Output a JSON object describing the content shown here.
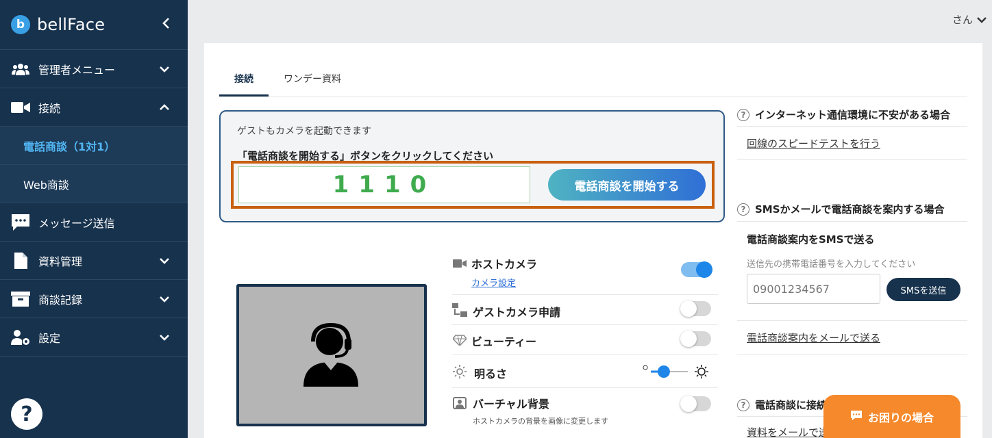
{
  "brand": {
    "logo_letter": "b",
    "name": "bellFace"
  },
  "sidebar": {
    "items": [
      {
        "label": "管理者メニュー",
        "icon": "users-icon",
        "expanded": false
      },
      {
        "label": "接続",
        "icon": "video-camera-icon",
        "expanded": true
      },
      {
        "label": "電話商談（1対1）",
        "sub": true,
        "active": true
      },
      {
        "label": "Web商談",
        "sub": true
      },
      {
        "label": "メッセージ送信",
        "icon": "chat-icon"
      },
      {
        "label": "資料管理",
        "icon": "document-icon",
        "expanded": false
      },
      {
        "label": "商談記録",
        "icon": "archive-icon",
        "expanded": false
      },
      {
        "label": "設定",
        "icon": "user-gear-icon",
        "expanded": false
      }
    ],
    "help_label": "?"
  },
  "header": {
    "user_label": "さん"
  },
  "tabs": [
    {
      "label": "接続",
      "active": true
    },
    {
      "label": "ワンデー資料",
      "active": false
    }
  ],
  "start": {
    "note": "ゲストもカメラを起動できます",
    "instruction": "「電話商談を開始する」ボタンをクリックしてください",
    "code": "1110",
    "button_label": "電話商談を開始する"
  },
  "settings": {
    "host_camera": {
      "label": "ホストカメラ",
      "link": "カメラ設定",
      "on": true
    },
    "guest_camera": {
      "label": "ゲストカメラ申請",
      "on": false
    },
    "beauty": {
      "label": "ビューティー",
      "on": false
    },
    "brightness": {
      "label": "明るさ",
      "level": 0.35
    },
    "virtual_bg": {
      "label": "バーチャル背景",
      "desc": "ホストカメラの背景を画像に変更します",
      "on": false
    }
  },
  "right": {
    "internet": {
      "title": "インターネット通信環境に不安がある場合",
      "link": "回線のスピードテストを行う"
    },
    "sms": {
      "title": "SMSかメールで電話商談を案内する場合",
      "sub": "電話商談案内をSMSで送る",
      "hint": "送信先の携帯電話番号を入力してください",
      "placeholder": "09001234567",
      "button": "SMSを送信",
      "mail_link": "電話商談案内をメールで送る"
    },
    "connect": {
      "title": "電話商談に接続",
      "link": "資料をメールで送"
    }
  },
  "trouble_label": "お困りの場合",
  "colors": {
    "sidebar": "#17324d",
    "accent": "#1d86e8",
    "active_nav": "#52b6f4",
    "code": "#3fab4e",
    "highlight": "#c8600f",
    "trouble": "#f5892b"
  }
}
